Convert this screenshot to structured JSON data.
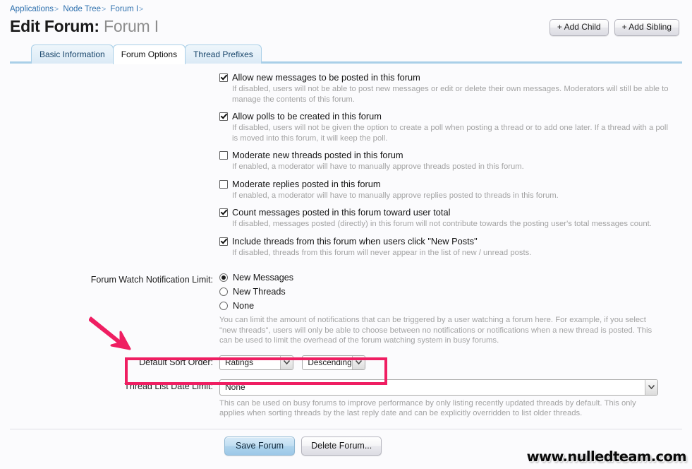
{
  "breadcrumb": {
    "items": [
      {
        "label": "Applications",
        "sep": ">"
      },
      {
        "label": "Node Tree",
        "sep": ">"
      },
      {
        "label": "Forum I",
        "sep": ">"
      }
    ]
  },
  "header": {
    "title_prefix": "Edit Forum:",
    "title_name": "Forum I",
    "buttons": [
      {
        "label": "+ Add Child"
      },
      {
        "label": "+ Add Sibling"
      }
    ]
  },
  "tabs": [
    {
      "label": "Basic Information",
      "active": false
    },
    {
      "label": "Forum Options",
      "active": true
    },
    {
      "label": "Thread Prefixes",
      "active": false
    }
  ],
  "checkboxes": [
    {
      "label": "Allow new messages to be posted in this forum",
      "checked": true,
      "hint": "If disabled, users will not be able to post new messages or edit or delete their own messages. Moderators will still be able to manage the contents of this forum."
    },
    {
      "label": "Allow polls to be created in this forum",
      "checked": true,
      "hint": "If disabled, users will not be given the option to create a poll when posting a thread or to add one later. If a thread with a poll is moved into this forum, it will keep the poll."
    },
    {
      "label": "Moderate new threads posted in this forum",
      "checked": false,
      "hint": "If enabled, a moderator will have to manually approve threads posted in this forum."
    },
    {
      "label": "Moderate replies posted in this forum",
      "checked": false,
      "hint": "If enabled, a moderator will have to manually approve replies posted to threads in this forum."
    },
    {
      "label": "Count messages posted in this forum toward user total",
      "checked": true,
      "hint": "If disabled, messages posted (directly) in this forum will not contribute towards the posting user's total messages count."
    },
    {
      "label": "Include threads from this forum when users click \"New Posts\"",
      "checked": true,
      "hint": "If disabled, threads from this forum will never appear in the list of new / unread posts."
    }
  ],
  "watch_limit": {
    "label": "Forum Watch Notification Limit:",
    "options": [
      {
        "label": "New Messages",
        "selected": true
      },
      {
        "label": "New Threads",
        "selected": false
      },
      {
        "label": "None",
        "selected": false
      }
    ],
    "hint": "You can limit the amount of notifications that can be triggered by a user watching a forum here. For example, if you select \"new threads\", users will only be able to choose between no notifications or notifications when a new thread is posted. This can be used to limit the overhead of the forum watching system in busy forums."
  },
  "sort_order": {
    "label": "Default Sort Order:",
    "field_value": "Ratings",
    "direction_value": "Descending",
    "highlight_color": "#ef1e62"
  },
  "date_limit": {
    "label": "Thread List Date Limit:",
    "value": "None",
    "hint": "This can be used on busy forums to improve performance by only listing recently updated threads by default. This only applies when sorting threads by the last reply date and can be explicitly overridden to list older threads."
  },
  "footer": {
    "save_label": "Save Forum",
    "delete_label": "Delete Forum..."
  },
  "annotation": {
    "arrow_color": "#ef1e62"
  },
  "watermark": {
    "text": "www.nulledteam.com"
  }
}
